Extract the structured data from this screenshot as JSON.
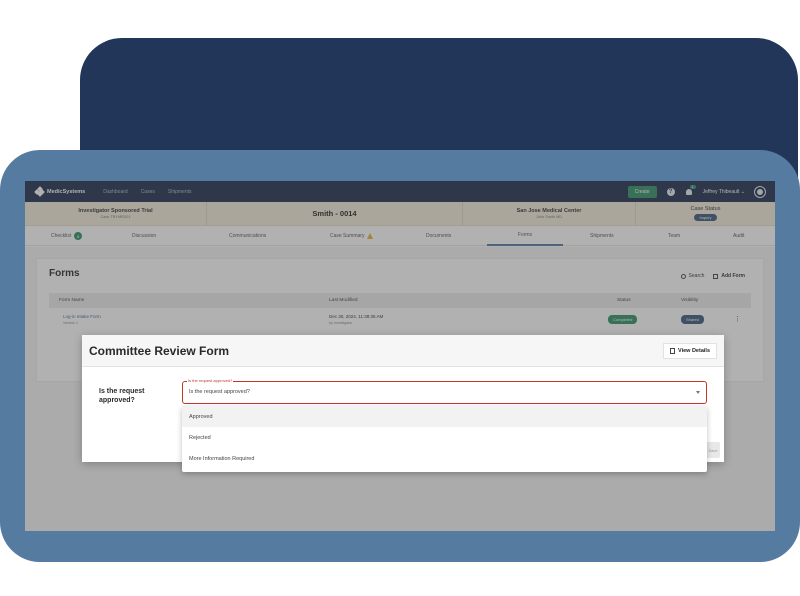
{
  "nav": {
    "brand": "MedicSystems",
    "links": [
      "Dashboard",
      "Cases",
      "Shipments"
    ],
    "create_label": "Create",
    "help_icon": "?",
    "notification_count": "1",
    "user_name": "Jeffrey Thibeault"
  },
  "case": {
    "trial_title": "Investigator Sponsored Trial",
    "trial_sub": "Case TRYMED01",
    "case_id": "Smith - 0014",
    "center_title": "San Jose Medical Center",
    "center_sub": "John Smith MD",
    "status_label": "Case Status",
    "status_value": "Inquiry"
  },
  "tabs": [
    {
      "label": "Checklist",
      "badge": "8"
    },
    {
      "label": "Discussion"
    },
    {
      "label": "Communications"
    },
    {
      "label": "Case Summary"
    },
    {
      "label": "Documents"
    },
    {
      "label": "Forms"
    },
    {
      "label": "Shipments"
    },
    {
      "label": "Team"
    },
    {
      "label": "Audit"
    }
  ],
  "forms": {
    "title": "Forms",
    "search_label": "Search",
    "add_label": "Add Form",
    "columns": [
      "Form Name",
      "Last Modified",
      "Status",
      "Visibility"
    ],
    "row": {
      "name": "Log-in Intake Form",
      "version": "Version 1",
      "modified": "Dec 30, 2024, 11:38:35 AM",
      "modified_by": "by Investigator",
      "status": "Completed",
      "visibility": "Shared"
    }
  },
  "modal": {
    "title": "Committee Review Form",
    "view_details_label": "View Details",
    "question": "Is the request approved?",
    "select_float_label": "Is the request approved?",
    "select_value": "Is the request approved?",
    "options": [
      "Approved",
      "Rejected",
      "More Information Required"
    ],
    "faded_button": "Save"
  }
}
